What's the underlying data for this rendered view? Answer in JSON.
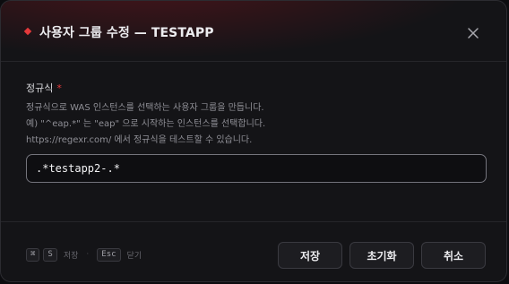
{
  "dialog": {
    "title": "사용자 그룹 수정 — TESTAPP",
    "accent_color": "#e5393b",
    "close_icon": "close-icon"
  },
  "form": {
    "label": "정규식",
    "required_mark": "*",
    "help_lines": [
      "정규식으로 WAS 인스턴스를 선택하는 사용자 그룹을 만듭니다.",
      "예) \"^eap.*\" 는 \"eap\" 으로 시작하는 인스턴스를 선택합니다.",
      "https://regexr.com/ 에서 정규식을 테스트할 수 있습니다."
    ],
    "regex_value": ".*testapp2-.*"
  },
  "shortcuts": {
    "save_keys": [
      "⌘",
      "S"
    ],
    "save_label": "저장",
    "separator": "·",
    "close_key": "Esc",
    "close_label": "닫기"
  },
  "buttons": {
    "save": "저장",
    "reset": "초기화",
    "cancel": "취소"
  }
}
